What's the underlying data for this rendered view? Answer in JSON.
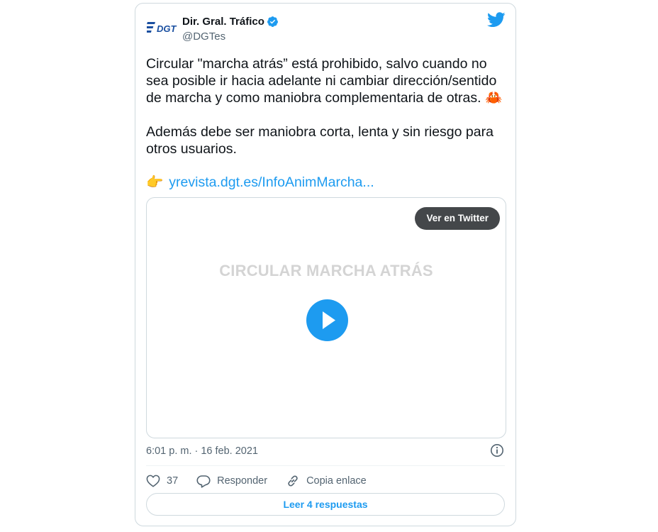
{
  "tweet": {
    "author_name": "Dir. Gral. Tráfico",
    "handle": "@DGTes",
    "logo_text": "DGT",
    "verified": true,
    "text_line1": "Circular \"marcha atrás” está prohibido, salvo cuando no",
    "text_line2": "sea posible ir hacia adelante ni cambiar dirección/sentido",
    "text_line3": "de marcha y como maniobra complementaria de otras. 🦀",
    "text_line4": "Además debe ser maniobra corta, lenta y sin riesgo para",
    "text_line5": "otros usuarios.",
    "pointer_emoji": "👉",
    "link_text": "yrevista.dgt.es/InfoAnimMarcha...",
    "timestamp": "6:01 p. m. · 16 feb. 2021"
  },
  "media": {
    "view_button_label": "Ver en Twitter",
    "title": "CIRCULAR MARCHA ATRÁS"
  },
  "actions": {
    "likes_count": "37",
    "reply_label": "Responder",
    "copy_link_label": "Copia enlace",
    "read_replies_label": "Leer 4 respuestas"
  },
  "icons": {
    "brand": "twitter-bird-icon",
    "verified": "verified-badge-icon",
    "info": "info-icon",
    "like": "heart-icon",
    "reply": "reply-bubble-icon",
    "copy": "link-icon",
    "play": "play-icon"
  },
  "colors": {
    "accent": "#1d9bf0",
    "text": "#0f1419",
    "secondary": "#536471",
    "border": "#cfd9de",
    "dgt_logo": "#1a4fa0"
  }
}
